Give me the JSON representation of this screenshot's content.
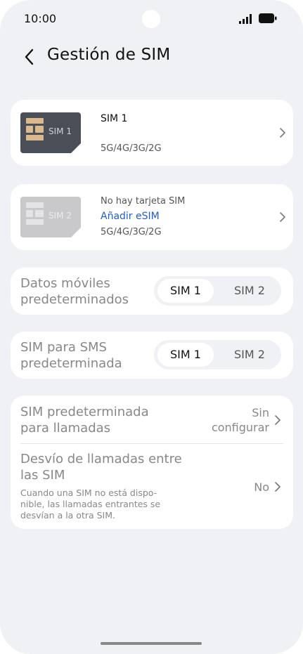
{
  "status_bar": {
    "time": "10:00"
  },
  "header": {
    "title": "Gestión de SIM"
  },
  "sim1": {
    "card_label": "SIM 1",
    "name": "SIM 1",
    "networks": "5G/4G/3G/2G"
  },
  "sim2": {
    "card_label": "SIM 2",
    "status": "No hay tarjeta SIM",
    "add_esim": "Añadir eSIM",
    "networks": "5G/4G/3G/2G"
  },
  "mobile_data": {
    "label_line1": "Datos móviles",
    "label_line2": "predeterminados",
    "option1": "SIM 1",
    "option2": "SIM 2",
    "selected": "SIM 1"
  },
  "sms": {
    "label_line1": "SIM para SMS",
    "label_line2": "predeterminada",
    "option1": "SIM 1",
    "option2": "SIM 2",
    "selected": "SIM 1"
  },
  "calls": {
    "title_line1": "SIM predeterminada",
    "title_line2": "para llamadas",
    "value_line1": "Sin",
    "value_line2": "configurar"
  },
  "forwarding": {
    "title_line1": "Desvío de llamadas entre",
    "title_line2": "las SIM",
    "desc_line1": "Cuando una SIM no está dispo-",
    "desc_line2": "nible, las llamadas entrantes se",
    "desc_line3": "desvían a la otra SIM.",
    "value": "No"
  },
  "colors": {
    "background": "#f0f1f4",
    "card": "#ffffff",
    "link": "#1f5fcf",
    "sim1_card": "#4a4e57",
    "sim2_card": "#c9c9cb",
    "sim_chip_gold": "#d9b98d"
  }
}
